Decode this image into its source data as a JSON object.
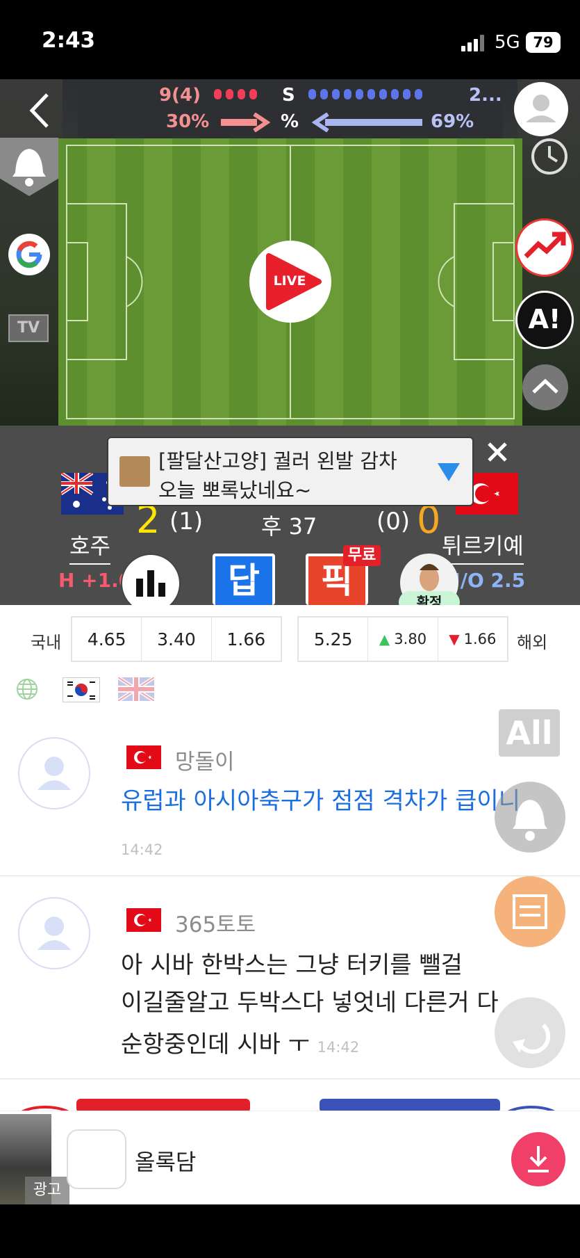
{
  "status_bar": {
    "time": "2:43",
    "network": "5G",
    "battery": "79"
  },
  "top_stats": {
    "left_count": "9(4)",
    "label_s": "S",
    "right_count": "2...",
    "left_pct": "30%",
    "label_pct": "%",
    "right_pct": "69%"
  },
  "live_label": "LIVE",
  "tv_label": "TV",
  "ai_label": "A!",
  "chat_popup": {
    "line1": "[팔달산고양] 궐러 왼발 감차",
    "line2": "오늘 뽀록났네요~"
  },
  "match": {
    "home_name": "호주",
    "away_name": "튀르키예",
    "home_score": "2",
    "home_half": "(1)",
    "away_score": "0",
    "away_half": "(0)",
    "time": "후 37",
    "home_handicap": "H +1.0",
    "away_handicap": "U/O 2.5",
    "answer_label": "답",
    "pick_label": "픽",
    "free_label": "무료",
    "confirm_label": "확정"
  },
  "odds": {
    "domestic_label": "국내",
    "domestic": [
      "4.65",
      "3.40",
      "1.66"
    ],
    "overseas_label": "해외",
    "overseas": [
      "5.25",
      "3.80",
      "1.66"
    ]
  },
  "all_label": "All",
  "comments": [
    {
      "nick": "망돌이",
      "text": "유럽과 아시아축구가 점점 격차가 큽이니",
      "time": "14:42"
    },
    {
      "nick": "365토토",
      "line1": "아 시바 한박스는 그냥 터키를 뺄걸",
      "line2": "이길줄알고 두박스다 넣엇네 다른거 다",
      "line3": "순항중인데 시바 ㅜ",
      "time": "14:42"
    }
  ],
  "bottom": {
    "ad_label": "광고",
    "title": "올록담"
  },
  "colors": {
    "red": "#f23a3a",
    "pink": "#f0406a",
    "blue": "#1a73e8",
    "yellow": "#ffe600",
    "orange": "#f5a623"
  }
}
